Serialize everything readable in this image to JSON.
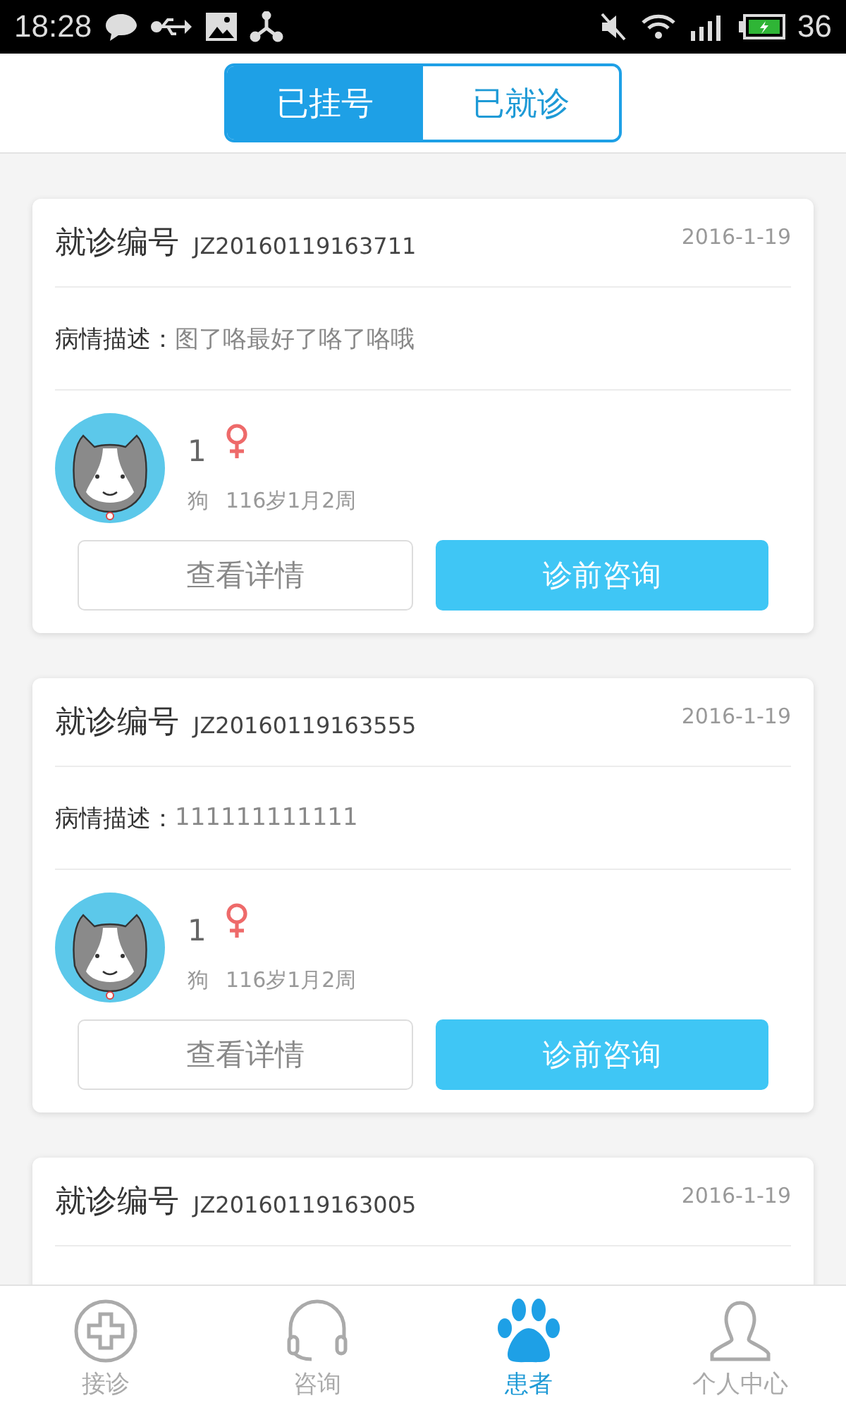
{
  "status_bar": {
    "time": "18:28",
    "battery": "36"
  },
  "segments": [
    {
      "label": "已挂号",
      "selected": true
    },
    {
      "label": "已就诊",
      "selected": false
    }
  ],
  "records": [
    {
      "number_label": "就诊编号",
      "number": "JZ20160119163711",
      "date": "2016-1-19",
      "description_label": "病情描述：",
      "description": "图了咯最好了咯了咯哦",
      "pet": {
        "name": "1",
        "female": true,
        "species": "狗",
        "age": "116岁1月2周"
      },
      "buttons": [
        "查看详情",
        "诊前咨询"
      ]
    },
    {
      "number_label": "就诊编号",
      "number": "JZ20160119163555",
      "date": "2016-1-19",
      "description_label": "病情描述：",
      "description": "111111111111",
      "pet": {
        "name": "1",
        "female": true,
        "species": "狗",
        "age": "116岁1月2周"
      },
      "buttons": [
        "查看详情",
        "诊前咨询"
      ]
    },
    {
      "number_label": "就诊编号",
      "number": "JZ20160119163005",
      "date": "2016-1-19"
    }
  ],
  "tab_bar": [
    {
      "kind": "clinic",
      "label": "接诊",
      "selected": false
    },
    {
      "kind": "consult",
      "label": "咨询",
      "selected": false
    },
    {
      "kind": "patients",
      "label": "患者",
      "selected": true
    },
    {
      "kind": "profile",
      "label": "个人中心",
      "selected": false
    }
  ]
}
